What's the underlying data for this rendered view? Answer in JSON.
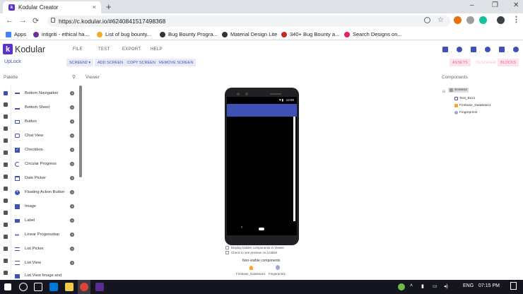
{
  "browser": {
    "tab_title": "Kodular Creator",
    "tab_close": "×",
    "new_tab": "+",
    "url": "https://c.kodular.io/#6240841517498368",
    "window_controls": {
      "minimize": "–",
      "restore": "❐",
      "close": "✕"
    },
    "nav": {
      "back": "←",
      "forward": "→",
      "reload": "⟳"
    }
  },
  "bookmarks": [
    {
      "label": "Apps",
      "color": "#4285f4"
    },
    {
      "label": "intigriti - ethical ha...",
      "color": "#6b2fa0"
    },
    {
      "label": "List of bug bounty...",
      "color": "#f9a825"
    },
    {
      "label": "Bug Bounty Progra...",
      "color": "#333333"
    },
    {
      "label": "Material Design Lite",
      "color": "#333333"
    },
    {
      "label": "340+ Bug Bounty a...",
      "color": "#c62828"
    },
    {
      "label": "Search Designs on...",
      "color": "#e91e63"
    }
  ],
  "app": {
    "logo_letter": "k",
    "name": "Kodular",
    "menu": [
      "FILE",
      "TEST",
      "EXPORT",
      "HELP"
    ],
    "project_name": "UpLock",
    "toolbar": {
      "screen_select": "SCREEN2 ▾",
      "add_screen": "ADD SCREEN",
      "copy_screen": "COPY SCREEN",
      "remove_screen": "REMOVE SCREEN",
      "assets": "ASSETS",
      "designer": "DESIGNER",
      "blocks": "BLOCKS"
    }
  },
  "palette": {
    "header": "Palette",
    "items": [
      "Bottom Navigation",
      "Bottom Sheet",
      "Button",
      "Chat View",
      "Checkbox",
      "Circular Progress",
      "Date Picker",
      "Floating Action Button",
      "Image",
      "Label",
      "Linear Progressbar",
      "List Picker",
      "List View",
      "List View Image and"
    ],
    "help_glyph": "?"
  },
  "viewer": {
    "header": "Viewer",
    "status_time": "12:00",
    "options": [
      "Display hidden components in Viewer",
      "Check to see preview on a tablet"
    ],
    "nonvisible_header": "Non-visible components",
    "nonvisible_items": [
      "Firebase_Database1",
      "Fingerprint1"
    ]
  },
  "components": {
    "header": "Components",
    "tree": [
      "Screen2",
      "Text_Box1",
      "Firebase_Database1",
      "Fingerprint1"
    ]
  },
  "taskbar": {
    "language": "ENG",
    "time": "07:15 PM"
  },
  "colors": {
    "accent": "#3f51b5",
    "brand": "#5c33c9",
    "pink": "#f48fb1"
  }
}
